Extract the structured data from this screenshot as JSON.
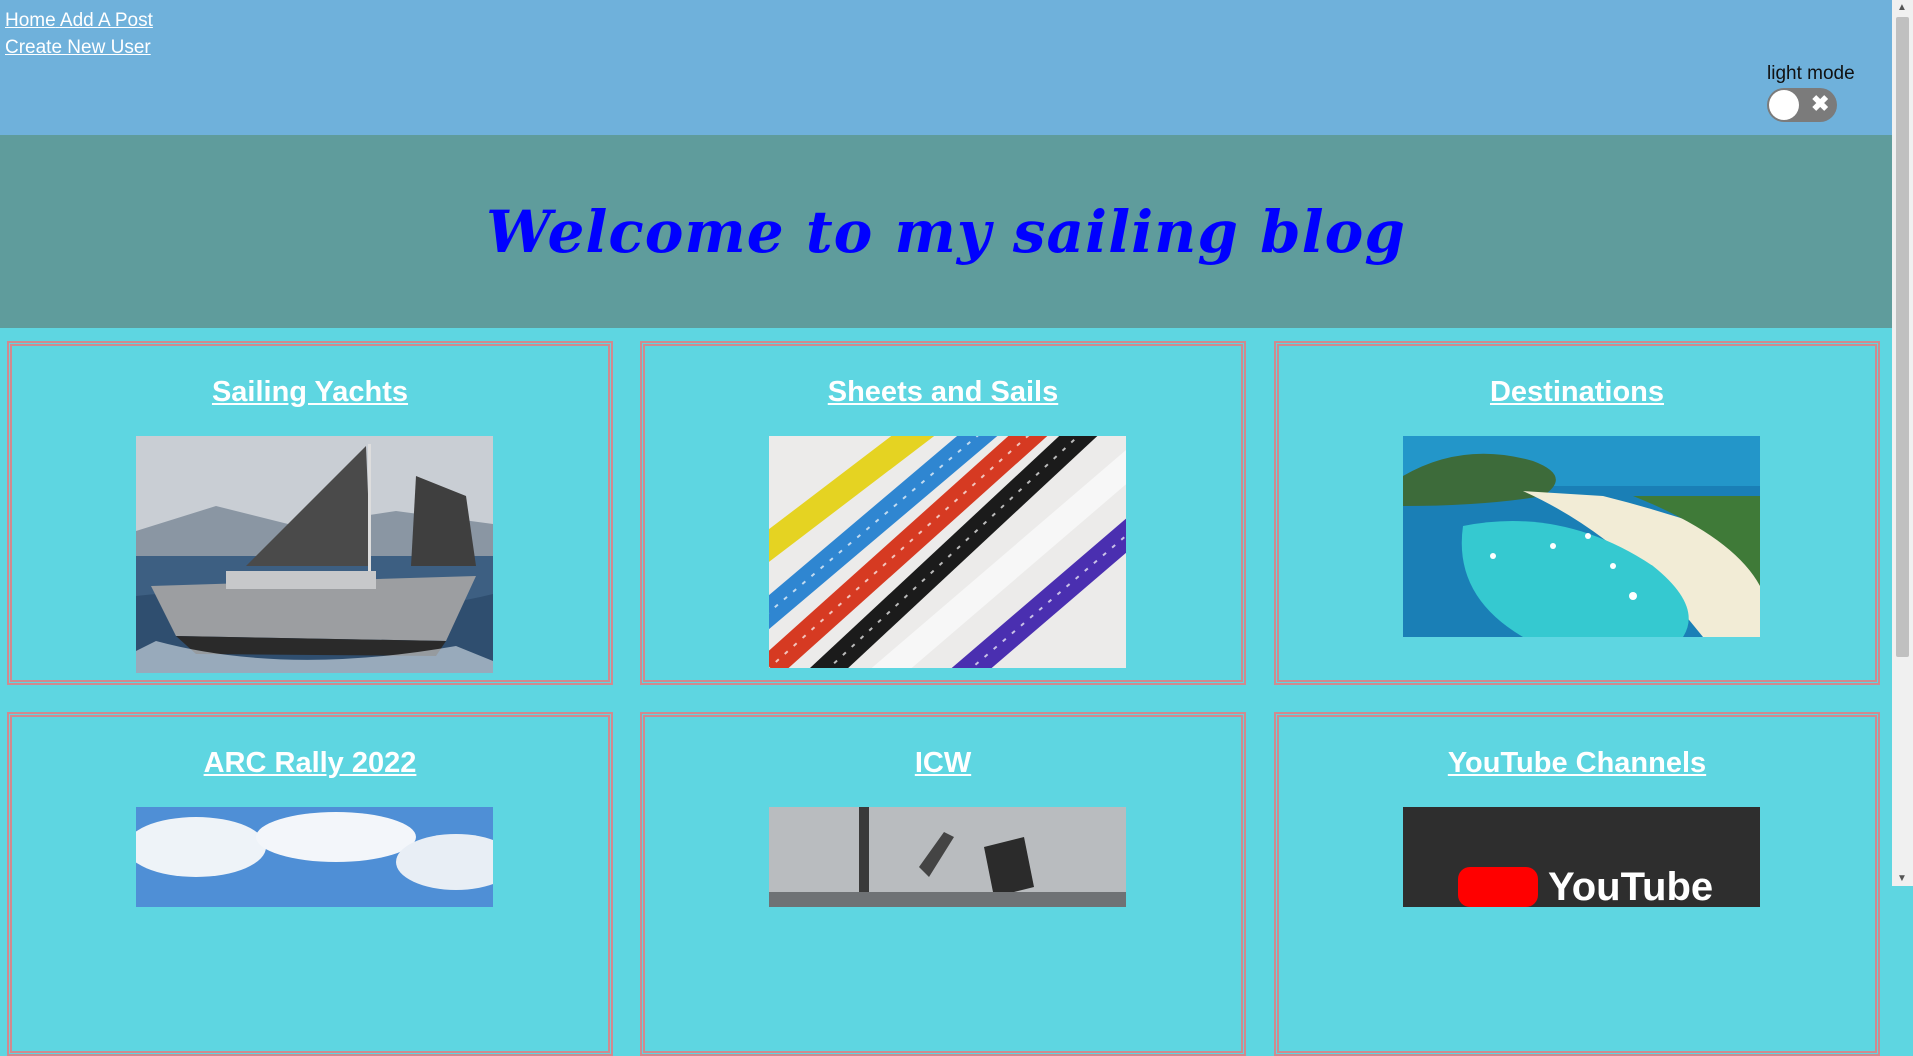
{
  "nav": {
    "home": "Home",
    "add_post": "Add A Post",
    "create_user": "Create New User"
  },
  "theme": {
    "label": "light mode",
    "toggle_icon": "✖"
  },
  "hero": {
    "title": "Welcome to my sailing blog"
  },
  "cards": [
    {
      "title": "Sailing Yachts"
    },
    {
      "title": "Sheets and Sails"
    },
    {
      "title": "Destinations"
    },
    {
      "title": "ARC Rally 2022"
    },
    {
      "title": "ICW"
    },
    {
      "title": "YouTube Channels"
    }
  ],
  "youtube_logo_text": "YouTube"
}
